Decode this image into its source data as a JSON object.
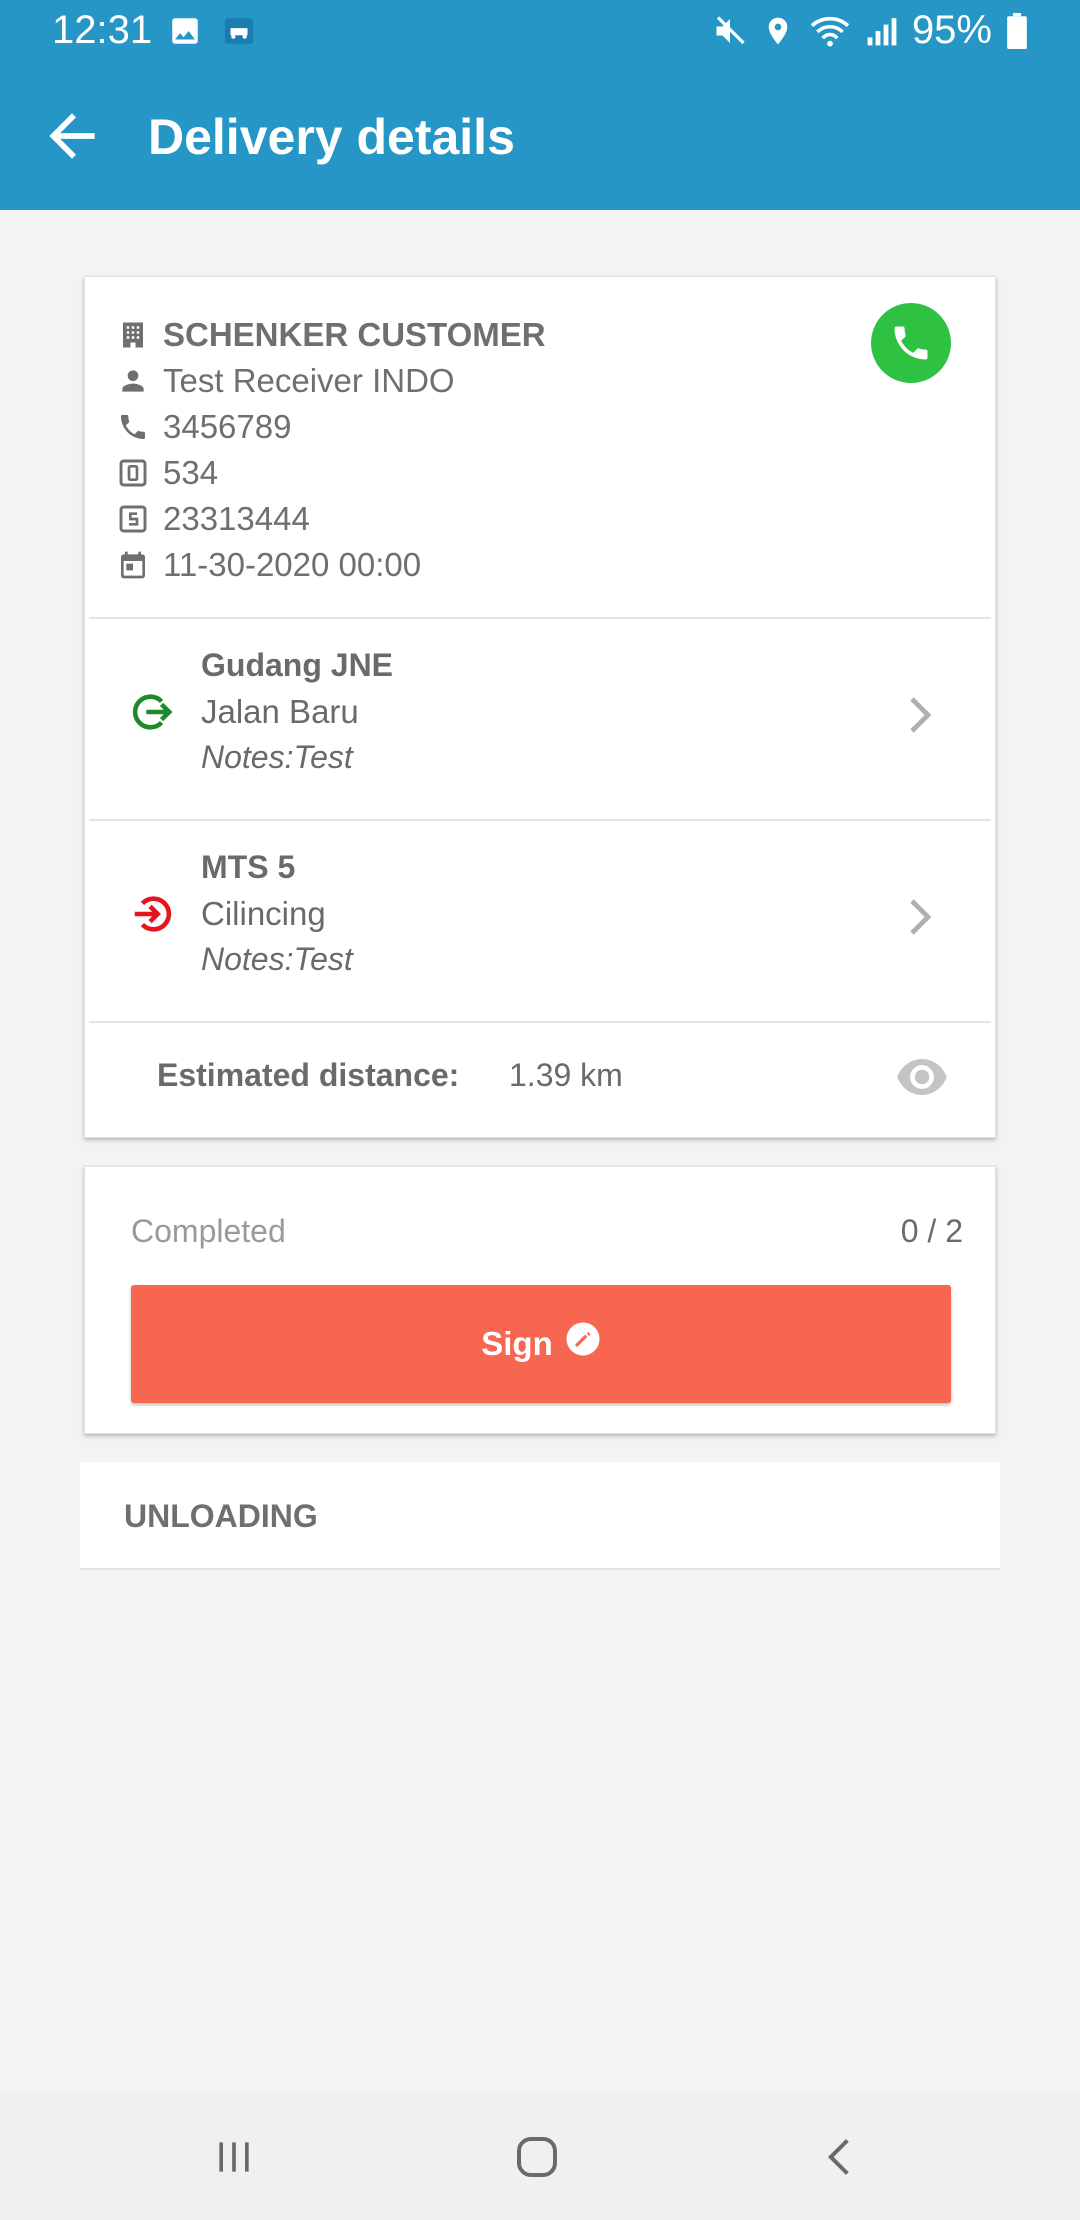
{
  "status_bar": {
    "time": "12:31",
    "battery": "95%",
    "icons": [
      "gallery-icon",
      "app-notification-icon",
      "mute-icon",
      "location-icon",
      "wifi-icon",
      "signal-icon",
      "battery-icon"
    ]
  },
  "app_bar": {
    "title": "Delivery details",
    "back_icon": "arrow-back-icon"
  },
  "customer": {
    "company": "SCHENKER CUSTOMER",
    "receiver": "Test Receiver INDO",
    "phone": "3456789",
    "order_number": "534",
    "shipment_number": "23313444",
    "datetime": "11-30-2020 00:00",
    "call_icon": "phone-icon"
  },
  "stops": [
    {
      "name": "Gudang JNE",
      "address": "Jalan Baru",
      "notes": "Notes:Test",
      "type": "pickup",
      "color": "#1e8a2c"
    },
    {
      "name": "MTS 5",
      "address": "Cilincing",
      "notes": "Notes:Test",
      "type": "dropoff",
      "color": "#e5141d"
    }
  ],
  "distance": {
    "label": "Estimated distance:",
    "value": "1.39 km"
  },
  "completion": {
    "label": "Completed",
    "count": "0 / 2",
    "sign_label": "Sign"
  },
  "section": {
    "title": "UNLOADING"
  },
  "colors": {
    "header": "#2596c5",
    "call_button": "#2ec142",
    "sign_button": "#f66650"
  }
}
